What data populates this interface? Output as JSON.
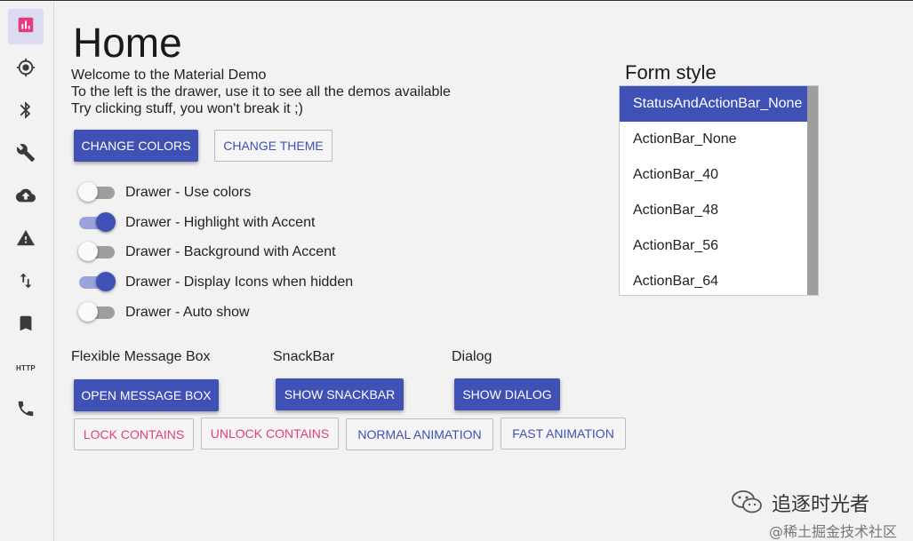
{
  "drawer": {
    "items": [
      {
        "icon": "chart-icon",
        "active": true
      },
      {
        "icon": "crosshair-icon"
      },
      {
        "icon": "bluetooth-icon"
      },
      {
        "icon": "wrench-icon"
      },
      {
        "icon": "cloud-upload-icon"
      },
      {
        "icon": "warning-icon"
      },
      {
        "icon": "swap-vertical-icon"
      },
      {
        "icon": "bookmark-icon"
      },
      {
        "icon": "http-icon",
        "text": "HTTP"
      },
      {
        "icon": "phone-icon"
      }
    ]
  },
  "main": {
    "title": "Home",
    "intro": [
      "Welcome to the Material Demo",
      "To the left is the drawer, use it to see all the demos available",
      "Try clicking stuff, you won't break it ;)"
    ],
    "change_colors_label": "CHANGE COLORS",
    "change_theme_label": "CHANGE THEME",
    "toggles": [
      {
        "label": "Drawer - Use colors",
        "on": false
      },
      {
        "label": "Drawer - Highlight with Accent",
        "on": true
      },
      {
        "label": "Drawer - Background with Accent",
        "on": false
      },
      {
        "label": "Drawer - Display Icons when hidden",
        "on": true
      },
      {
        "label": "Drawer - Auto show",
        "on": false
      }
    ],
    "sections": {
      "message_box": "Flexible Message Box",
      "snackbar": "SnackBar",
      "dialog": "Dialog"
    },
    "open_message_box_label": "OPEN MESSAGE BOX",
    "show_snackbar_label": "SHOW SNACKBAR",
    "show_dialog_label": "SHOW DIALOG",
    "lock_contains_label": "LOCK CONTAINS",
    "unlock_contains_label": "UNLOCK CONTAINS",
    "normal_animation_label": "NORMAL ANIMATION",
    "fast_animation_label": "FAST ANIMATION"
  },
  "form_style": {
    "title": "Form style",
    "options": [
      "StatusAndActionBar_None",
      "ActionBar_None",
      "ActionBar_40",
      "ActionBar_48",
      "ActionBar_56",
      "ActionBar_64"
    ],
    "selected": "StatusAndActionBar_None"
  },
  "watermark": {
    "name": "追逐时光者",
    "site": "@稀土掘金技术社区"
  },
  "colors": {
    "primary": "#3f51b5",
    "accent_pink": "#e63c7d",
    "toggle_track_on": "#9aa3dc",
    "background": "#f2f2f2"
  }
}
